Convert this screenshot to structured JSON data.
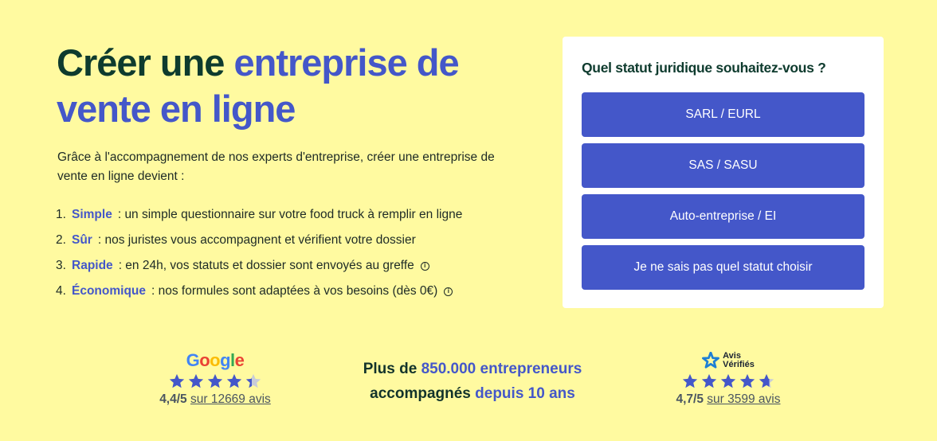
{
  "hero": {
    "title_part1": "Créer une ",
    "title_accent_line1": "entreprise de",
    "title_accent_line2": "vente en ligne",
    "intro": "Grâce à l'accompagnement de nos experts d'entreprise, créer une entreprise de vente en ligne devient :"
  },
  "benefits": [
    {
      "num": "1.",
      "key": "Simple",
      "text": ": un simple questionnaire sur votre food truck à remplir en ligne",
      "info": false
    },
    {
      "num": "2.",
      "key": "Sûr",
      "text": ": nos juristes vous accompagnent et vérifient votre dossier",
      "info": false
    },
    {
      "num": "3.",
      "key": "Rapide",
      "text": ": en 24h, vos statuts et dossier sont envoyés au greffe",
      "info": true
    },
    {
      "num": "4.",
      "key": "Économique",
      "text": ": nos formules sont adaptées à vos besoins (dès 0€)",
      "info": true
    }
  ],
  "info_glyph": "i",
  "card": {
    "question": "Quel statut juridique souhaitez-vous ?",
    "options": [
      "SARL / EURL",
      "SAS / SASU",
      "Auto-entreprise / EI",
      "Je ne sais pas quel statut choisir"
    ]
  },
  "google": {
    "logo_letters": [
      "G",
      "o",
      "o",
      "g",
      "l",
      "e"
    ],
    "score": "4,4/5",
    "reviews_link": "sur 12669 avis",
    "stars_value": 4.4
  },
  "stats": {
    "line1_prefix": "Plus de ",
    "line1_accent": "850.000 entrepreneurs",
    "line2_prefix": "accompagnés ",
    "line2_accent": "depuis 10 ans"
  },
  "avis": {
    "logo_line1": "Avis",
    "logo_line2": "Vérifiés",
    "score": "4,7/5",
    "reviews_link": "sur 3599 avis",
    "stars_value": 4.7
  },
  "colors": {
    "background": "#fffaa0",
    "accent": "#4457c9",
    "title_dark": "#0e3b2e",
    "star_empty": "#c8ccd8"
  }
}
